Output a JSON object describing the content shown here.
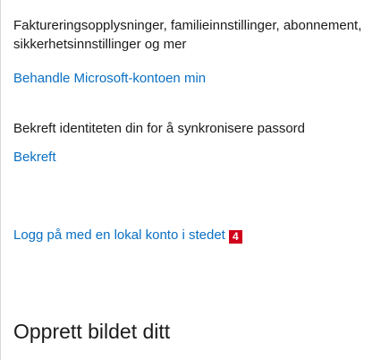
{
  "account": {
    "description_line1": "Faktureringsopplysninger, familieinnstillinger, abonnement,",
    "description_line2": "sikkerhetsinnstillinger og mer",
    "manage_link": "Behandle Microsoft-kontoen min"
  },
  "identity": {
    "text": "Bekreft identiteten din for å synkronisere passord",
    "verify_link": "Bekreft"
  },
  "local_account": {
    "link": "Logg på med en lokal konto i stedet",
    "badge": "4",
    "badge_color": "#d0021b"
  },
  "picture": {
    "heading": "Opprett bildet ditt"
  },
  "colors": {
    "link": "#0a6fc2",
    "text": "#1a1a1a"
  }
}
